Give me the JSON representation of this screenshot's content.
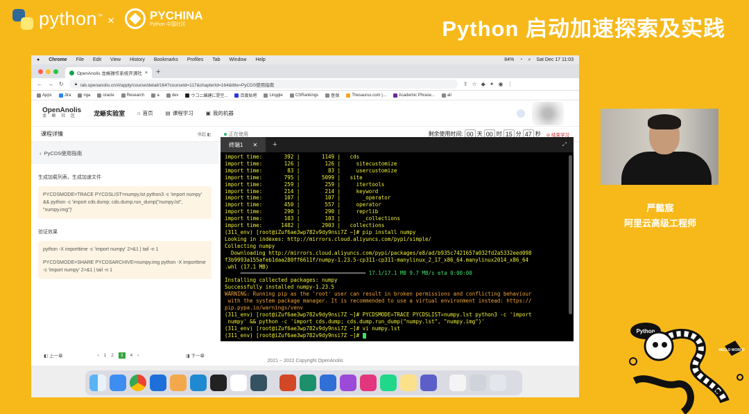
{
  "slide": {
    "brand_python": "python",
    "brand_tm": "™",
    "times": "×",
    "brand_pychina": "PYCHINA",
    "brand_pychina_sub": "Python 中国社区",
    "title": "Python 启动加速探索及实践"
  },
  "menubar": {
    "app": "Chrome",
    "items": [
      "File",
      "Edit",
      "View",
      "History",
      "Bookmarks",
      "Profiles",
      "Tab",
      "Window",
      "Help"
    ],
    "battery": "84%",
    "datetime": "Sat Dec 17  11:03"
  },
  "browser": {
    "tab_title": "OpenAnolis 龙蜥操作系统开源社",
    "url": "lab.openanolis.cn/#/apply/course/detail/164?courseId=117&chapterId=164&title=PyCDS使用指南",
    "bookmarks": [
      "Apps",
      "Jira",
      "nga",
      "oracle",
      "Research",
      "a",
      "dev",
      "ウコニ編建に是空...",
      "百度贴吧",
      "Linggle",
      "CSRankings",
      "医保",
      "Thesaurus.com |...",
      "Academic Phrase...",
      "ali"
    ]
  },
  "site": {
    "logo_main": "OpenAnolis",
    "logo_sub": "龙 蜥 社 区",
    "lab": "龙蜥实验室",
    "nav": [
      "首页",
      "课程学习",
      "我的机器"
    ],
    "course_details": "课程详情",
    "fold": "收起",
    "status": "正在使用",
    "remaining_label": "剩余使用时间:",
    "timer": {
      "days": "00",
      "days_unit": "天",
      "hours": "00",
      "hours_unit": "时",
      "minutes": "15",
      "minutes_unit": "分",
      "seconds": "47",
      "seconds_unit": "秒"
    },
    "end_study": "结束学习",
    "back_link": "PyCDS使用指南",
    "section1": "生成加载列表，生成加速文件",
    "code1": "PYCDSMODE=TRACE PYCDSLIST=numpy.lst python3 -c 'import numpy' && python -c 'import cds.dump; cds.dump.run_dump(\"numpy.lst\", \"numpy.img\")'",
    "section2": "验证效果",
    "code2a": "python -X importtime -c 'import numpy' 2>&1 | tail -n 1",
    "code2b": "PYCDSMODE=SHARE PYCDSARCHIVE=numpy.img python -X importtime -c 'import numpy' 2>&1 | tail -n 1",
    "prev": "上一章",
    "next": "下一章",
    "pages": [
      "1",
      "2",
      "3",
      "4"
    ],
    "current_page": "3",
    "copyright": "2021 ~ 2022 Copyright OpenAnolis"
  },
  "terminal": {
    "tab": "终端1",
    "lines": [
      {
        "c": "y",
        "t": "import time:       392 |       1149 |   cds"
      },
      {
        "c": "y",
        "t": "import time:       126 |        126 |     sitecustomize"
      },
      {
        "c": "y",
        "t": "import time:        83 |         83 |     usercustomize"
      },
      {
        "c": "y",
        "t": "import time:       795 |       5099 |   site"
      },
      {
        "c": "y",
        "t": "import time:       259 |        259 |     itertools"
      },
      {
        "c": "y",
        "t": "import time:       214 |        214 |     keyword"
      },
      {
        "c": "y",
        "t": "import time:       107 |        107 |       _operator"
      },
      {
        "c": "y",
        "t": "import time:       450 |        557 |     operator"
      },
      {
        "c": "y",
        "t": "import time:       290 |        290 |     reprlib"
      },
      {
        "c": "y",
        "t": "import time:       103 |        103 |       _collections"
      },
      {
        "c": "y",
        "t": "import time:      1482 |       2903 |   collections"
      },
      {
        "c": "y",
        "t": "(311_env) [root@iZuf6ae3wp782v9dy9nsi7Z ~]# pip install numpy"
      },
      {
        "c": "y",
        "t": "Looking in indexes: http://mirrors.cloud.aliyuncs.com/pypi/simple/"
      },
      {
        "c": "y",
        "t": "Collecting numpy"
      },
      {
        "c": "y",
        "t": "  Downloading http://mirrors.cloud.aliyuncs.com/pypi/packages/e8/ad/b935c7421657a032fd2a5332eed098"
      },
      {
        "c": "y",
        "t": "f3b9993a155afeb1daa280ff6611f/numpy-1.23.5-cp311-cp311-manylinux_2_17_x86_64.manylinux2014_x86_64"
      },
      {
        "c": "y",
        "t": ".whl (17.1 MB)"
      },
      {
        "c": "p",
        "t": "     ━━━━━━━━━━━━━━━━━━━━━━━━━━━━━━━━━━━━━━━━ 17.1/17.1 MB 9.7 MB/s eta 0:00:00"
      },
      {
        "c": "y",
        "t": "Installing collected packages: numpy"
      },
      {
        "c": "y",
        "t": "Successfully installed numpy-1.23.5"
      },
      {
        "c": "o",
        "t": "WARNING: Running pip as the 'root' user can result in broken permissions and conflicting behaviour"
      },
      {
        "c": "o",
        "t": " with the system package manager. It is recommended to use a virtual environment instead: https://"
      },
      {
        "c": "o",
        "t": "pip.pypa.io/warnings/venv"
      },
      {
        "c": "y",
        "t": "(311_env) [root@iZuf6ae3wp782v9dy9nsi7Z ~]# PYCDSMODE=TRACE PYCDSLIST=numpy.lst python3 -c 'import"
      },
      {
        "c": "y",
        "t": " numpy' && python -c 'import cds.dump; cds.dump.run_dump(\"numpy.lst\", \"numpy.img\")'"
      },
      {
        "c": "y",
        "t": "(311_env) [root@iZuf6ae3wp782v9dy9nsi7Z ~]# vi numpy.lst"
      },
      {
        "c": "y",
        "t": "(311_env) [root@iZuf6ae3wp782v9dy9nsi7Z ~]# "
      }
    ]
  },
  "speaker": {
    "name": "严懿宸",
    "title": "阿里云高级工程师"
  },
  "mascot": {
    "badge_left": "Python",
    "badge_right": "HELLO WORLD"
  },
  "colors": {
    "slide_bg": "#f7b91a",
    "term_text": "#f1f13a",
    "accent_green": "#2fa63a"
  }
}
